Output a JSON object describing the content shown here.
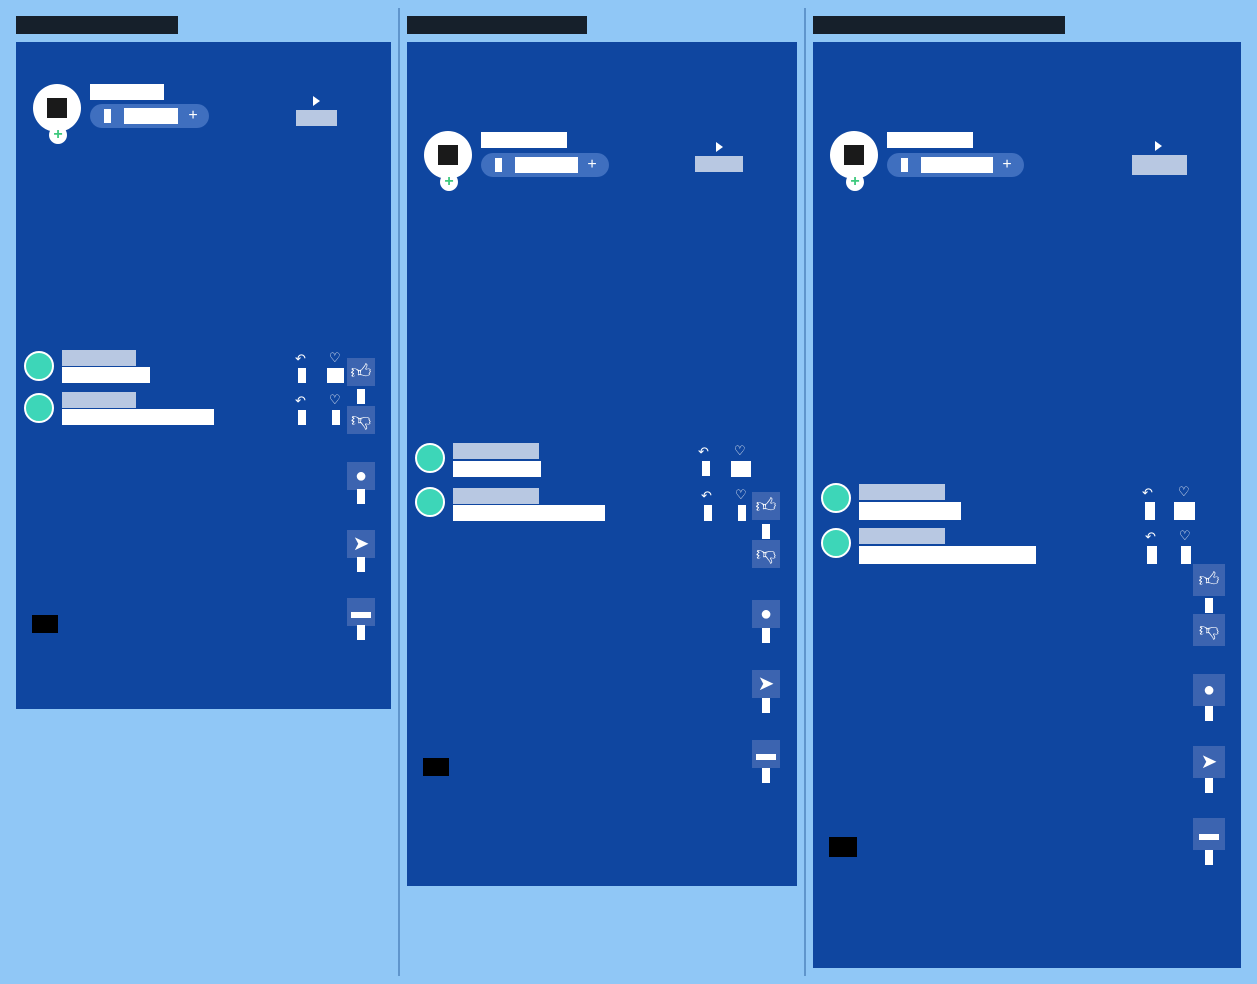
{
  "layout_title": "",
  "columns": [
    {
      "label": ""
    },
    {
      "label": ""
    },
    {
      "label": ""
    }
  ],
  "screens": [
    {
      "profile": {
        "name": "",
        "pill_value": "",
        "add_symbol": "+"
      },
      "play": {
        "symbol": "▸",
        "label": ""
      },
      "comments": [
        {
          "user": "",
          "text": "",
          "reply_count": "",
          "like_count": ""
        },
        {
          "user": "",
          "text": "",
          "reply_count": "",
          "like_count": ""
        }
      ],
      "rail": {
        "like_icon": "thumbs-up",
        "dislike_icon": "thumbs-down",
        "comment_icon": "chat-bubble",
        "share_icon": "paper-plane",
        "save_icon": "bookmark"
      }
    },
    {
      "profile": {
        "name": "",
        "pill_value": "",
        "add_symbol": "+"
      },
      "play": {
        "symbol": "▸",
        "label": ""
      },
      "comments": [
        {
          "user": "",
          "text": "",
          "reply_count": "",
          "like_count": ""
        },
        {
          "user": "",
          "text": "",
          "reply_count": "",
          "like_count": ""
        }
      ],
      "rail": {
        "like_icon": "thumbs-up",
        "dislike_icon": "thumbs-down",
        "comment_icon": "chat-bubble",
        "share_icon": "paper-plane",
        "save_icon": "bookmark"
      }
    },
    {
      "profile": {
        "name": "",
        "pill_value": "",
        "add_symbol": "+"
      },
      "play": {
        "symbol": "▸",
        "label": ""
      },
      "comments": [
        {
          "user": "",
          "text": "",
          "reply_count": "",
          "like_count": ""
        },
        {
          "user": "",
          "text": "",
          "reply_count": "",
          "like_count": ""
        }
      ],
      "rail": {
        "like_icon": "thumbs-up",
        "dislike_icon": "thumbs-down",
        "comment_icon": "chat-bubble",
        "share_icon": "paper-plane",
        "save_icon": "bookmark"
      }
    }
  ],
  "colors": {
    "page_background": "#90c7f6",
    "screen_background": "#0f46a0",
    "accent_teal": "#3dd6b8",
    "accent_green": "#3ec97d",
    "text_muted": "#b8c8e2"
  }
}
